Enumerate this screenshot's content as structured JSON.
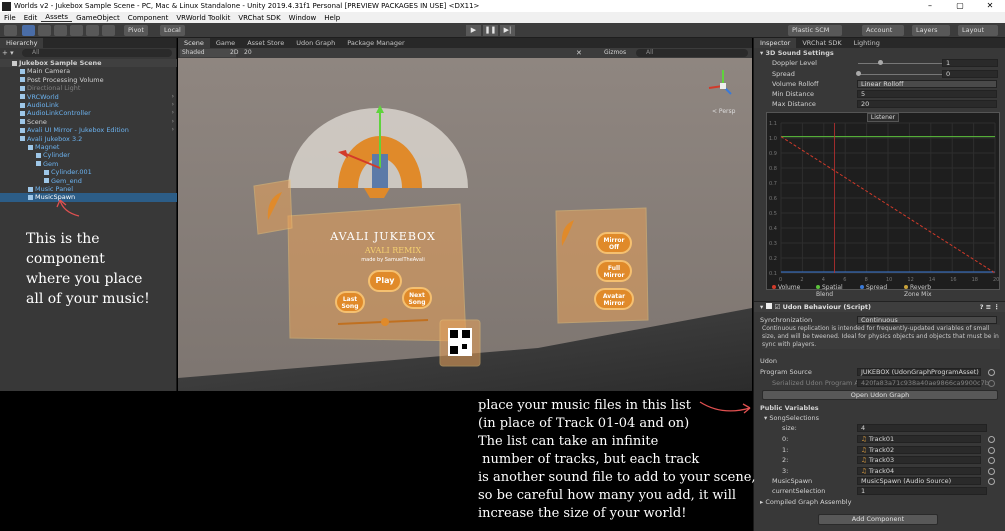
{
  "window": {
    "title": "Worlds v2 - Jukebox Sample Scene - PC, Mac & Linux Standalone - Unity 2019.4.31f1 Personal [PREVIEW PACKAGES IN USE] <DX11>",
    "minimize": "–",
    "maximize": "▢",
    "close": "✕"
  },
  "menu": [
    "File",
    "Edit",
    "Assets",
    "GameObject",
    "Component",
    "VRWorld Toolkit",
    "VRChat SDK",
    "Window",
    "Help"
  ],
  "toolbar": {
    "pivot": "Pivot",
    "local": "Local",
    "plastic": "Plastic SCM",
    "account": "Account",
    "layers": "Layers",
    "layout": "Layout",
    "play": "▶",
    "pause": "❚❚",
    "step": "▶|"
  },
  "hierarchy": {
    "tab": "Hierarchy",
    "search_placeholder": "All",
    "items": [
      {
        "label": "Jukebox Sample Scene",
        "indent": 1,
        "style": "root"
      },
      {
        "label": "Main Camera",
        "indent": 2,
        "style": "normal"
      },
      {
        "label": "Post Processing Volume",
        "indent": 2,
        "style": "normal"
      },
      {
        "label": "Directional Light",
        "indent": 2,
        "style": "dim"
      },
      {
        "label": "VRCWorld",
        "indent": 2,
        "style": "blue"
      },
      {
        "label": "AudioLink",
        "indent": 2,
        "style": "blue"
      },
      {
        "label": "AudioLinkController",
        "indent": 2,
        "style": "blue"
      },
      {
        "label": "Scene",
        "indent": 2,
        "style": "normal"
      },
      {
        "label": "Avali UI Mirror - Jukebox Edition",
        "indent": 2,
        "style": "blue"
      },
      {
        "label": "Avali Jukebox 3.2",
        "indent": 2,
        "style": "blue"
      },
      {
        "label": "Magnet",
        "indent": 3,
        "style": "blue"
      },
      {
        "label": "Cylinder",
        "indent": 4,
        "style": "blue"
      },
      {
        "label": "Gem",
        "indent": 4,
        "style": "blue"
      },
      {
        "label": "Cylinder.001",
        "indent": 5,
        "style": "blue"
      },
      {
        "label": "Gem_end",
        "indent": 5,
        "style": "blue"
      },
      {
        "label": "Music Panel",
        "indent": 3,
        "style": "blue"
      },
      {
        "label": "MusicSpawn",
        "indent": 3,
        "style": "selected"
      }
    ]
  },
  "scene": {
    "tabs": [
      "Scene",
      "Game",
      "Asset Store",
      "Udon Graph",
      "Package Manager"
    ],
    "shading": "Shaded",
    "mode_2d": "2D",
    "gizmo_num": "20",
    "gizmos": "Gizmos",
    "search_placeholder": "All",
    "persp": "< Persp",
    "panel_title": "AVALI JUKEBOX",
    "panel_subtitle": "AVALI REMIX",
    "panel_made_by": "made by SamuelTheAvali",
    "btn_play": "Play",
    "btn_last": "Last Song",
    "btn_next": "Next Song",
    "btn_mirror_off": "Mirror Off",
    "btn_full_mirror": "Full Mirror",
    "btn_avatar_mirror": "Avatar Mirror"
  },
  "inspector": {
    "tabs": [
      "Inspector",
      "VRChat SDK",
      "Lighting"
    ],
    "sound_header": "3D Sound Settings",
    "doppler_label": "Doppler Level",
    "doppler_value": "1",
    "spread_label": "Spread",
    "spread_value": "0",
    "rolloff_label": "Volume Rolloff",
    "rolloff_value": "Linear Rolloff",
    "mindist_label": "Min Distance",
    "mindist_value": "5",
    "maxdist_label": "Max Distance",
    "maxdist_value": "20",
    "graph_label": "Listener",
    "graph_yticks": [
      "1.1",
      "1.0",
      "0.9",
      "0.8",
      "0.7",
      "0.6",
      "0.5",
      "0.4",
      "0.3",
      "0.2",
      "0.1"
    ],
    "graph_xticks": [
      "0",
      "2",
      "4",
      "6",
      "8",
      "10",
      "12",
      "14",
      "16",
      "18",
      "20"
    ],
    "legend": [
      {
        "label": "Volume",
        "color": "#d23a2a"
      },
      {
        "label": "Spatial Blend",
        "color": "#5cc23c"
      },
      {
        "label": "Spread",
        "color": "#3a7ad8"
      },
      {
        "label": "Reverb Zone Mix",
        "color": "#c8a23a"
      }
    ],
    "udon_header": "Udon Behaviour (Script)",
    "sync_label": "Synchronization",
    "sync_value": "Continuous",
    "sync_help": "Continuous replication is intended for frequently-updated variables of small size, and will be tweened. Ideal for physics objects and objects that must be in sync with players.",
    "udon_label": "Udon",
    "program_label": "Program Source",
    "program_value": "JUKEBOX (UdonGraphProgramAsset)",
    "serialized_label": "Serialized Udon Program Ass",
    "serialized_value": "420fa83a71c938a40ae9866ca9900c7b",
    "open_graph": "Open Udon Graph",
    "public_vars": "Public Variables",
    "song_label": "SongSelections",
    "size_label": "size:",
    "size_value": "4",
    "tracks": [
      {
        "idx": "0:",
        "name": "Track01"
      },
      {
        "idx": "1:",
        "name": "Track02"
      },
      {
        "idx": "2:",
        "name": "Track03"
      },
      {
        "idx": "3:",
        "name": "Track04"
      }
    ],
    "musicspawn_label": "MusicSpawn",
    "musicspawn_value": "MusicSpawn (Audio Source)",
    "current_label": "currentSelection",
    "current_value": "1",
    "compiled": "Compiled Graph Assembly",
    "add_component": "Add Component"
  },
  "annotations": {
    "left_note": [
      "This is the",
      "component",
      "where you place",
      "all of your music!"
    ],
    "bottom_note": [
      "place your music files in this list",
      "(in place of Track 01-04 and on)",
      "The list can take an infinite",
      " number of tracks, but each track",
      "is another sound file to add to your scene,",
      "so be careful how many you add, it will",
      "increase the size of your world!"
    ]
  }
}
